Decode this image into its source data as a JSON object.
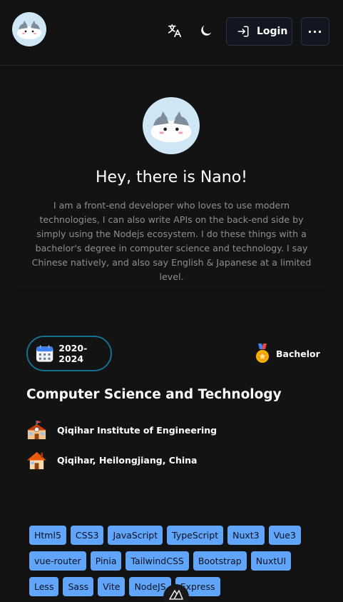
{
  "header": {
    "avatar_alt": "Nano avatar",
    "login_label": "Login",
    "more_label": "···",
    "icons": [
      "translate-icon",
      "moon-icon",
      "login-icon",
      "more-icon"
    ]
  },
  "intro": {
    "greeting": "Hey, there is Nano!",
    "bio": "I am a front-end developer who loves to use modern technologies, I can also write APIs on the back-end side by simply using the Nodejs ecosystem. I do these things with a bachelor's degree in computer science and technology. I say Chinese natively, and also say English & Japanese at a limited level."
  },
  "education": {
    "period": "2020-2024",
    "degree": "Bachelor",
    "major": "Computer Science and Technology",
    "school": "Qiqihar Institute of Engineering",
    "location": "Qiqihar, Heilongjiang, China",
    "icons": [
      "calendar-icon",
      "medal-icon",
      "school-icon",
      "house-icon"
    ]
  },
  "skills": [
    "Html5",
    "CSS3",
    "JavaScript",
    "TypeScript",
    "Nuxt3",
    "Vue3",
    "vue-router",
    "Pinia",
    "TailwindCSS",
    "Bootstrap",
    "NuxtUI",
    "Less",
    "Sass",
    "Vite",
    "NodeJS",
    "Express"
  ],
  "colors": {
    "background": "#121212",
    "tag": "#60a5fa",
    "pill_border": "#16708f",
    "avatar_bg": "#cfe7f5"
  }
}
